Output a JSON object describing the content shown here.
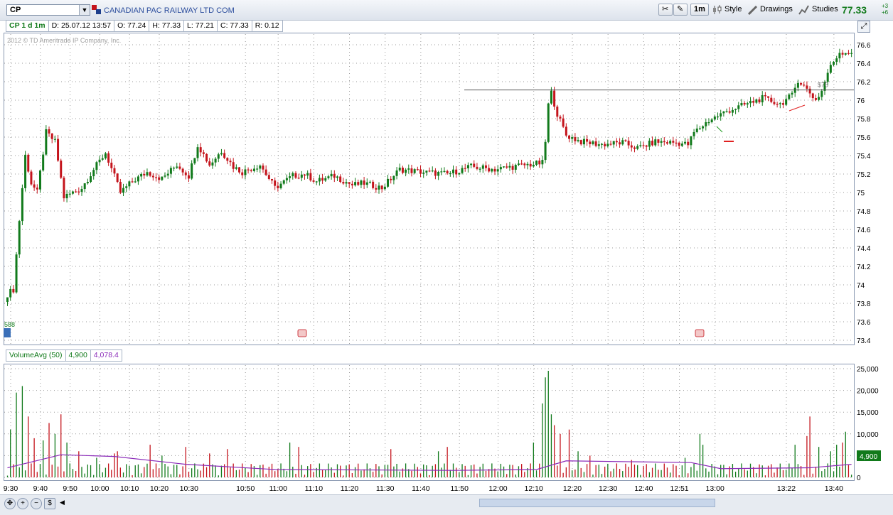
{
  "header": {
    "symbol": "CP",
    "company": "CANADIAN PAC RAILWAY LTD COM",
    "period_btn": "1m",
    "style_btn": "Style",
    "drawings_btn": "Drawings",
    "studies_btn": "Studies",
    "last_price": "77.33",
    "change_top": "+3",
    "change_bottom": "+6"
  },
  "infobar": {
    "label": "CP 1 d 1m",
    "date": "D: 25.07.12 13:57",
    "open": "O: 77.24",
    "high": "H: 77.33",
    "low": "L: 77.21",
    "close": "C: 77.33",
    "range": "R: 0.12"
  },
  "watermark": "2012 © TD Ameritrade IP Company, Inc.",
  "volume_header": {
    "study": "VolumeAvg (50)",
    "volume": "4,900",
    "avg": "4,078.4"
  },
  "colors": {
    "up": "#117a1b",
    "down": "#c4141c",
    "avg_line": "#8a2ab8",
    "grid": "#9a9a9a"
  },
  "chart_data": [
    {
      "type": "candlestick",
      "ylim": [
        73.4,
        76.6
      ],
      "y_ticks": [
        "76.6",
        "76.4",
        "76.2",
        "76",
        "75.8",
        "75.6",
        "75.4",
        "75.2",
        "75",
        "74.8",
        "74.6",
        "74.4",
        "74.2",
        "74",
        "73.8",
        "73.6",
        "73.4"
      ],
      "x_ticks": [
        "9:30",
        "9:40",
        "9:50",
        "10:00",
        "10:10",
        "10:20",
        "10:30",
        "10:50",
        "11:00",
        "11:10",
        "11:20",
        "11:30",
        "11:40",
        "11:50",
        "12:00",
        "12:10",
        "12:20",
        "12:30",
        "12:40",
        "12:51",
        "13:00",
        "13:22",
        "13:40"
      ],
      "annotations": [
        "588",
        "$76"
      ],
      "reference_line": 76.11,
      "anchors": [
        {
          "i": 0,
          "p": 73.9
        },
        {
          "i": 2,
          "p": 73.95
        },
        {
          "i": 4,
          "p": 74.7
        },
        {
          "i": 6,
          "p": 75.4
        },
        {
          "i": 8,
          "p": 75.1
        },
        {
          "i": 10,
          "p": 75.0
        },
        {
          "i": 13,
          "p": 75.65
        },
        {
          "i": 16,
          "p": 75.55
        },
        {
          "i": 19,
          "p": 74.95
        },
        {
          "i": 22,
          "p": 75.0
        },
        {
          "i": 25,
          "p": 75.05
        },
        {
          "i": 29,
          "p": 75.25
        },
        {
          "i": 33,
          "p": 75.43
        },
        {
          "i": 38,
          "p": 75.0
        },
        {
          "i": 42,
          "p": 75.12
        },
        {
          "i": 47,
          "p": 75.22
        },
        {
          "i": 52,
          "p": 75.15
        },
        {
          "i": 57,
          "p": 75.3
        },
        {
          "i": 61,
          "p": 75.18
        },
        {
          "i": 64,
          "p": 75.52
        },
        {
          "i": 68,
          "p": 75.3
        },
        {
          "i": 72,
          "p": 75.45
        },
        {
          "i": 76,
          "p": 75.28
        },
        {
          "i": 79,
          "p": 75.22
        },
        {
          "i": 85,
          "p": 75.3
        },
        {
          "i": 90,
          "p": 75.05
        },
        {
          "i": 96,
          "p": 75.18
        },
        {
          "i": 100,
          "p": 75.2
        },
        {
          "i": 104,
          "p": 75.12
        },
        {
          "i": 110,
          "p": 75.18
        },
        {
          "i": 116,
          "p": 75.08
        },
        {
          "i": 120,
          "p": 75.1
        },
        {
          "i": 126,
          "p": 75.05
        },
        {
          "i": 132,
          "p": 75.25
        },
        {
          "i": 140,
          "p": 75.22
        },
        {
          "i": 148,
          "p": 75.2
        },
        {
          "i": 156,
          "p": 75.28
        },
        {
          "i": 164,
          "p": 75.25
        },
        {
          "i": 170,
          "p": 75.28
        },
        {
          "i": 175,
          "p": 75.3
        },
        {
          "i": 180,
          "p": 75.32
        },
        {
          "i": 181,
          "p": 75.55
        },
        {
          "i": 182,
          "p": 75.95
        },
        {
          "i": 183,
          "p": 76.08
        },
        {
          "i": 185,
          "p": 75.85
        },
        {
          "i": 188,
          "p": 75.62
        },
        {
          "i": 193,
          "p": 75.55
        },
        {
          "i": 200,
          "p": 75.52
        },
        {
          "i": 207,
          "p": 75.54
        },
        {
          "i": 212,
          "p": 75.48
        },
        {
          "i": 218,
          "p": 75.55
        },
        {
          "i": 225,
          "p": 75.54
        },
        {
          "i": 229,
          "p": 75.52
        },
        {
          "i": 231,
          "p": 75.65
        },
        {
          "i": 236,
          "p": 75.78
        },
        {
          "i": 242,
          "p": 75.88
        },
        {
          "i": 248,
          "p": 75.95
        },
        {
          "i": 254,
          "p": 76.02
        },
        {
          "i": 260,
          "p": 75.96
        },
        {
          "i": 264,
          "p": 76.05
        },
        {
          "i": 266,
          "p": 76.22
        },
        {
          "i": 268,
          "p": 76.15
        },
        {
          "i": 270,
          "p": 76.08
        },
        {
          "i": 272,
          "p": 76.0
        },
        {
          "i": 274,
          "p": 76.1
        },
        {
          "i": 276,
          "p": 76.3
        },
        {
          "i": 278,
          "p": 76.42
        },
        {
          "i": 280,
          "p": 76.52
        }
      ]
    },
    {
      "type": "bar",
      "title": "VolumeAvg (50)",
      "ylim": [
        0,
        25000
      ],
      "y_ticks": [
        "25,000",
        "20,000",
        "15,000",
        "10,000",
        "5,000",
        "0"
      ],
      "last_value": "4,900",
      "spikes": [
        {
          "i": 1,
          "v": 11000
        },
        {
          "i": 3,
          "v": 19500
        },
        {
          "i": 5,
          "v": 21000
        },
        {
          "i": 7,
          "v": 14000
        },
        {
          "i": 9,
          "v": 9000
        },
        {
          "i": 12,
          "v": 8500
        },
        {
          "i": 14,
          "v": 12500
        },
        {
          "i": 16,
          "v": 10000
        },
        {
          "i": 18,
          "v": 14500
        },
        {
          "i": 20,
          "v": 8000
        },
        {
          "i": 24,
          "v": 6000
        },
        {
          "i": 30,
          "v": 4500
        },
        {
          "i": 36,
          "v": 5500
        },
        {
          "i": 37,
          "v": 6000
        },
        {
          "i": 48,
          "v": 7500
        },
        {
          "i": 52,
          "v": 5000
        },
        {
          "i": 60,
          "v": 7000
        },
        {
          "i": 68,
          "v": 5500
        },
        {
          "i": 74,
          "v": 6500
        },
        {
          "i": 95,
          "v": 8000
        },
        {
          "i": 98,
          "v": 7000
        },
        {
          "i": 129,
          "v": 6500
        },
        {
          "i": 145,
          "v": 6000
        },
        {
          "i": 148,
          "v": 7000
        },
        {
          "i": 177,
          "v": 8000
        },
        {
          "i": 180,
          "v": 17000
        },
        {
          "i": 181,
          "v": 23000
        },
        {
          "i": 182,
          "v": 24500
        },
        {
          "i": 183,
          "v": 14500
        },
        {
          "i": 184,
          "v": 12000
        },
        {
          "i": 186,
          "v": 10000
        },
        {
          "i": 189,
          "v": 11000
        },
        {
          "i": 192,
          "v": 6000
        },
        {
          "i": 196,
          "v": 5000
        },
        {
          "i": 210,
          "v": 4000
        },
        {
          "i": 228,
          "v": 4500
        },
        {
          "i": 233,
          "v": 10000
        },
        {
          "i": 234,
          "v": 7500
        },
        {
          "i": 265,
          "v": 7500
        },
        {
          "i": 269,
          "v": 9500
        },
        {
          "i": 270,
          "v": 14000
        },
        {
          "i": 273,
          "v": 7000
        },
        {
          "i": 277,
          "v": 6000
        },
        {
          "i": 279,
          "v": 7500
        },
        {
          "i": 281,
          "v": 8000
        },
        {
          "i": 282,
          "v": 10500
        }
      ],
      "avg_line": [
        {
          "i": 0,
          "v": 2200
        },
        {
          "i": 18,
          "v": 5200
        },
        {
          "i": 36,
          "v": 4800
        },
        {
          "i": 60,
          "v": 3000
        },
        {
          "i": 90,
          "v": 1800
        },
        {
          "i": 150,
          "v": 1600
        },
        {
          "i": 178,
          "v": 1800
        },
        {
          "i": 188,
          "v": 3800
        },
        {
          "i": 230,
          "v": 3400
        },
        {
          "i": 240,
          "v": 2000
        },
        {
          "i": 270,
          "v": 2200
        },
        {
          "i": 284,
          "v": 3000
        }
      ]
    }
  ]
}
